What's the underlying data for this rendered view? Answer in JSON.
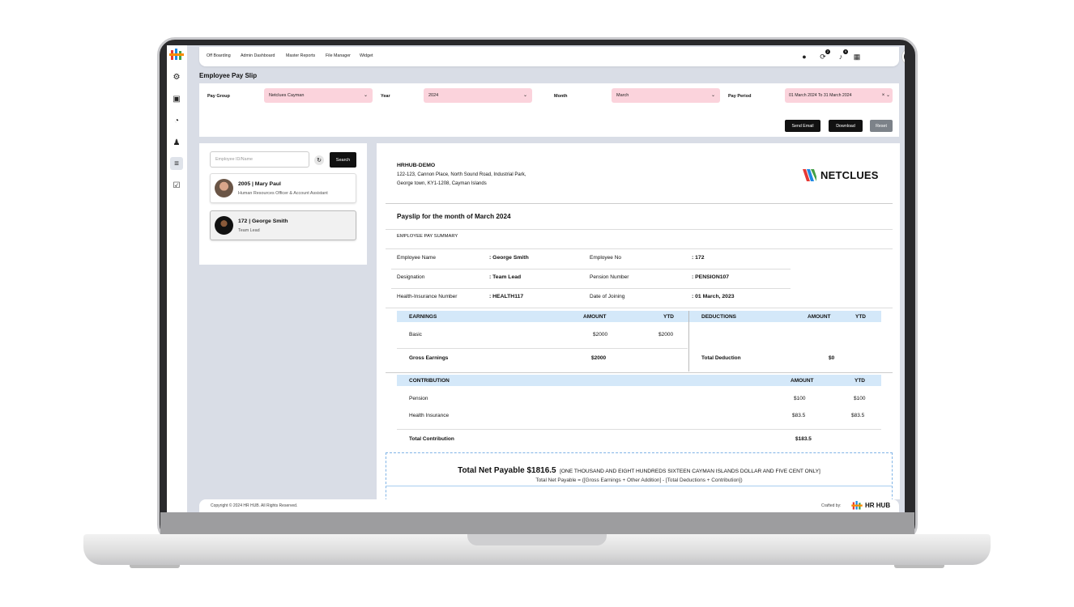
{
  "nav": {
    "items": [
      "Off Boarding",
      "Admin Dashboard",
      "Master Reports",
      "File Manager",
      "Widget"
    ],
    "badges": [
      "2",
      "9"
    ]
  },
  "page_title": "Employee Pay Slip",
  "filters": {
    "pay_group": {
      "label": "Pay Group",
      "value": "Netclues Cayman"
    },
    "year": {
      "label": "Year",
      "value": "2024"
    },
    "month": {
      "label": "Month",
      "value": "March"
    },
    "pay_period": {
      "label": "Pay Period",
      "value": "01 March 2024 To 31 March 2024"
    }
  },
  "buttons": {
    "send_email": "Send Email",
    "download": "Download",
    "reset": "Reset",
    "search": "Search"
  },
  "search": {
    "placeholder": "Employee ID/Name"
  },
  "employees": [
    {
      "title": "2005 | Mary Paul",
      "role": "Human Resources Officer & Account Assistant"
    },
    {
      "title": "172 | George Smith",
      "role": "Team Lead"
    }
  ],
  "company": {
    "name": "HRHUB-DEMO",
    "address1": "122-123, Cannon Place, North Sound Road, Industrial Park,",
    "address2": "George town, KY1-1208, Cayman Islands",
    "logo_text": "NETCLUES"
  },
  "payslip": {
    "heading": "Payslip for the month of March 2024",
    "summary_label": "EMPLOYEE PAY SUMMARY",
    "fields": {
      "employee_name": {
        "label": "Employee Name",
        "value": ": George Smith"
      },
      "employee_no": {
        "label": "Employee No",
        "value": ": 172"
      },
      "designation": {
        "label": "Designation",
        "value": ": Team Lead"
      },
      "pension_number": {
        "label": "Pension Number",
        "value": ": PENSION107"
      },
      "health_insurance": {
        "label": "Health-Insurance Number",
        "value": ": HEALTH117"
      },
      "date_of_joining": {
        "label": "Date of Joining",
        "value": ": 01 March, 2023"
      }
    },
    "earnings": {
      "header": "EARNINGS",
      "amount": "AMOUNT",
      "ytd": "YTD",
      "rows": [
        {
          "name": "Basic",
          "amount": "$2000",
          "ytd": "$2000"
        }
      ],
      "gross_label": "Gross Earnings",
      "gross_value": "$2000"
    },
    "deductions": {
      "header": "DEDUCTIONS",
      "amount": "AMOUNT",
      "ytd": "YTD",
      "total_label": "Total Deduction",
      "total_value": "$0"
    },
    "contribution": {
      "header": "CONTRIBUTION",
      "amount": "AMOUNT",
      "ytd": "YTD",
      "rows": [
        {
          "name": "Pension",
          "amount": "$100",
          "ytd": "$100"
        },
        {
          "name": "Health Insurance",
          "amount": "$83.5",
          "ytd": "$83.5"
        }
      ],
      "total_label": "Total Contribution",
      "total_value": "$183.5"
    },
    "net_payable": {
      "label": "Total Net Payable $1816.5",
      "words": "[ONE THOUSAND AND EIGHT HUNDREDS SIXTEEN CAYMAN ISLANDS DOLLAR AND FIVE CENT ONLY]",
      "formula": "Total Net Payable = ([Gross Earnings + Other Addition] - [Total Deductions + Contribution])"
    }
  },
  "footer": {
    "copyright": "Copyright © 2024 HR HUB. All Rights Reserved.",
    "crafted": "Crafted by:",
    "brand": "HR HUB"
  }
}
